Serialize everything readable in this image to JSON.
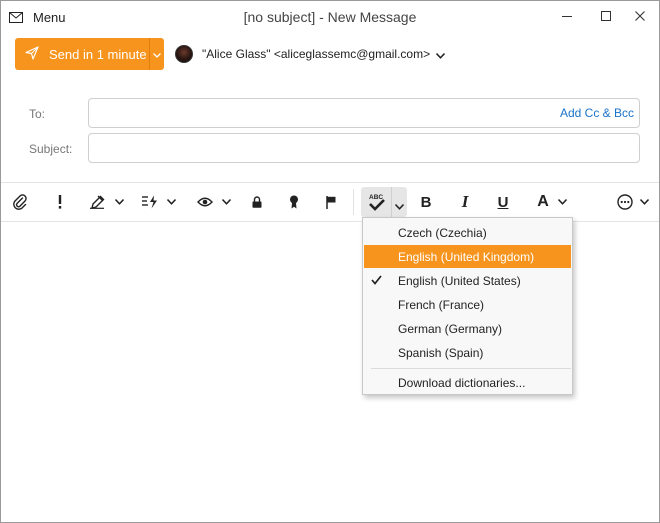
{
  "window": {
    "title": "[no subject] - New Message",
    "menu_label": "Menu"
  },
  "compose": {
    "send_label": "Send in 1 minute",
    "from": "\"Alice Glass\" <aliceglassemc@gmail.com>",
    "to_label": "To:",
    "to_value": "",
    "add_cc_bcc": "Add Cc & Bcc",
    "subject_label": "Subject:",
    "subject_value": ""
  },
  "toolbar": {
    "bold": "B",
    "italic": "I",
    "underline": "U",
    "font": "A",
    "spellcheck_icon_text": "ABC"
  },
  "spell_menu": {
    "items": [
      {
        "label": "Czech (Czechia)",
        "checked": false,
        "highlighted": false
      },
      {
        "label": "English (United Kingdom)",
        "checked": false,
        "highlighted": true
      },
      {
        "label": "English (United States)",
        "checked": true,
        "highlighted": false
      },
      {
        "label": "French (France)",
        "checked": false,
        "highlighted": false
      },
      {
        "label": "German (Germany)",
        "checked": false,
        "highlighted": false
      },
      {
        "label": "Spanish (Spain)",
        "checked": false,
        "highlighted": false
      }
    ],
    "download_label": "Download dictionaries..."
  },
  "colors": {
    "accent": "#f7941d",
    "link": "#1a73c9"
  },
  "icons": [
    "envelope-icon",
    "minimize-icon",
    "maximize-icon",
    "close-icon",
    "send-icon",
    "chevron-down-icon",
    "attachment-icon",
    "priority-icon",
    "signature-icon",
    "quick-text-icon",
    "read-receipt-icon",
    "encrypt-icon",
    "sign-icon",
    "flag-icon",
    "spellcheck-icon",
    "more-options-icon",
    "checkmark-icon"
  ]
}
